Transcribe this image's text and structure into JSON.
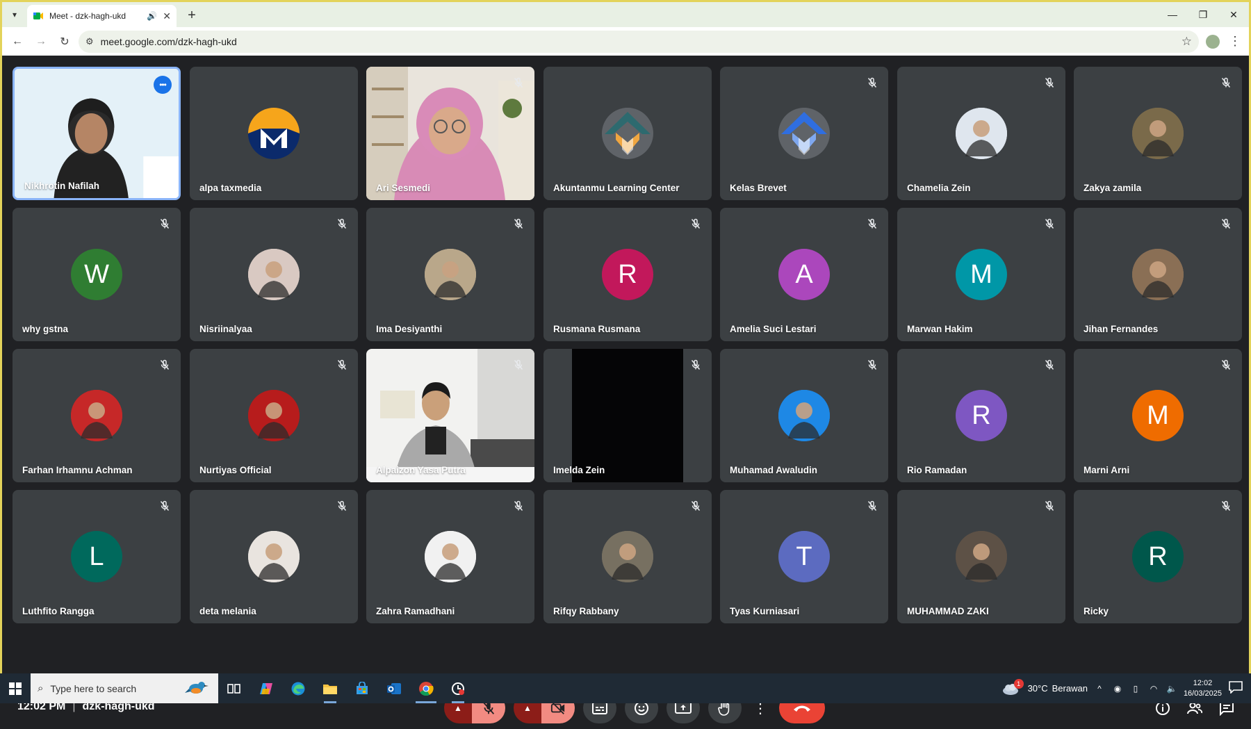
{
  "browser": {
    "tab_title": "Meet - dzk-hagh-ukd",
    "new_tab_label": "+",
    "url": "meet.google.com/dzk-hagh-ukd"
  },
  "participants": [
    {
      "name": "Nikhrotin Nafilah",
      "kind": "video",
      "active": true
    },
    {
      "name": "alpa taxmedia",
      "kind": "logo-taxmedia"
    },
    {
      "name": "Ari Sesmedi",
      "kind": "video-hijab",
      "muted": true
    },
    {
      "name": "Akuntanmu Learning Center",
      "kind": "logo-akuntanmu"
    },
    {
      "name": "Kelas Brevet",
      "kind": "logo-brevet",
      "muted": true
    },
    {
      "name": "Chamelia Zein",
      "kind": "photo",
      "color": "#dfe6ee",
      "muted": true
    },
    {
      "name": "Zakya zamila",
      "kind": "photo",
      "color": "#7a6a4a",
      "muted": true
    },
    {
      "name": "why gstna",
      "initial": "W",
      "color": "#2f7d32",
      "muted": true
    },
    {
      "name": "Nisriinalyaa",
      "kind": "photo",
      "color": "#d9c9c2",
      "muted": true
    },
    {
      "name": "Ima Desiyanthi",
      "kind": "photo",
      "color": "#b9a78a",
      "muted": true
    },
    {
      "name": "Rusmana Rusmana",
      "initial": "R",
      "color": "#c2185b",
      "muted": true
    },
    {
      "name": "Amelia Suci Lestari",
      "initial": "A",
      "color": "#ab47bc",
      "muted": true
    },
    {
      "name": "Marwan Hakim",
      "initial": "M",
      "color": "#0097a7",
      "muted": true
    },
    {
      "name": "Jihan Fernandes",
      "kind": "photo",
      "color": "#8a6f55",
      "muted": true
    },
    {
      "name": "Farhan Irhamnu Achman",
      "kind": "photo",
      "color": "#c62828",
      "muted": true
    },
    {
      "name": "Nurtiyas Official",
      "kind": "photo",
      "color": "#b71c1c",
      "muted": true
    },
    {
      "name": "Alpaizon Yasa Putra",
      "kind": "video-office",
      "muted": true
    },
    {
      "name": "Imelda Zein",
      "kind": "black",
      "muted": true
    },
    {
      "name": "Muhamad Awaludin",
      "kind": "photo",
      "color": "#1e88e5",
      "muted": true
    },
    {
      "name": "Rio Ramadan",
      "initial": "R",
      "color": "#7e57c2",
      "muted": true
    },
    {
      "name": "Marni Arni",
      "initial": "M",
      "color": "#ef6c00",
      "muted": true
    },
    {
      "name": "Luthfito Rangga",
      "initial": "L",
      "color": "#00695c",
      "muted": true
    },
    {
      "name": "deta melania",
      "kind": "photo",
      "color": "#e9e4df",
      "muted": true
    },
    {
      "name": "Zahra Ramadhani",
      "kind": "photo",
      "color": "#f1f1f1",
      "muted": true
    },
    {
      "name": "Rifqy Rabbany",
      "kind": "photo",
      "color": "#777061",
      "muted": true
    },
    {
      "name": "Tyas Kurniasari",
      "initial": "T",
      "color": "#5c6bc0",
      "muted": true
    },
    {
      "name": "MUHAMMAD ZAKI",
      "kind": "photo",
      "color": "#5d5146",
      "muted": true
    },
    {
      "name": "Ricky",
      "initial": "R",
      "color": "#00574b",
      "muted": true
    }
  ],
  "meeting": {
    "time": "12:02 PM",
    "separator": "|",
    "code": "dzk-hagh-ukd",
    "participant_count": "28",
    "warning_mark": "!"
  },
  "taskbar": {
    "search_placeholder": "Type here to search",
    "temperature": "30°C",
    "weather": "Berawan",
    "weather_alert": "1",
    "time": "12:02",
    "date": "16/03/2025"
  }
}
